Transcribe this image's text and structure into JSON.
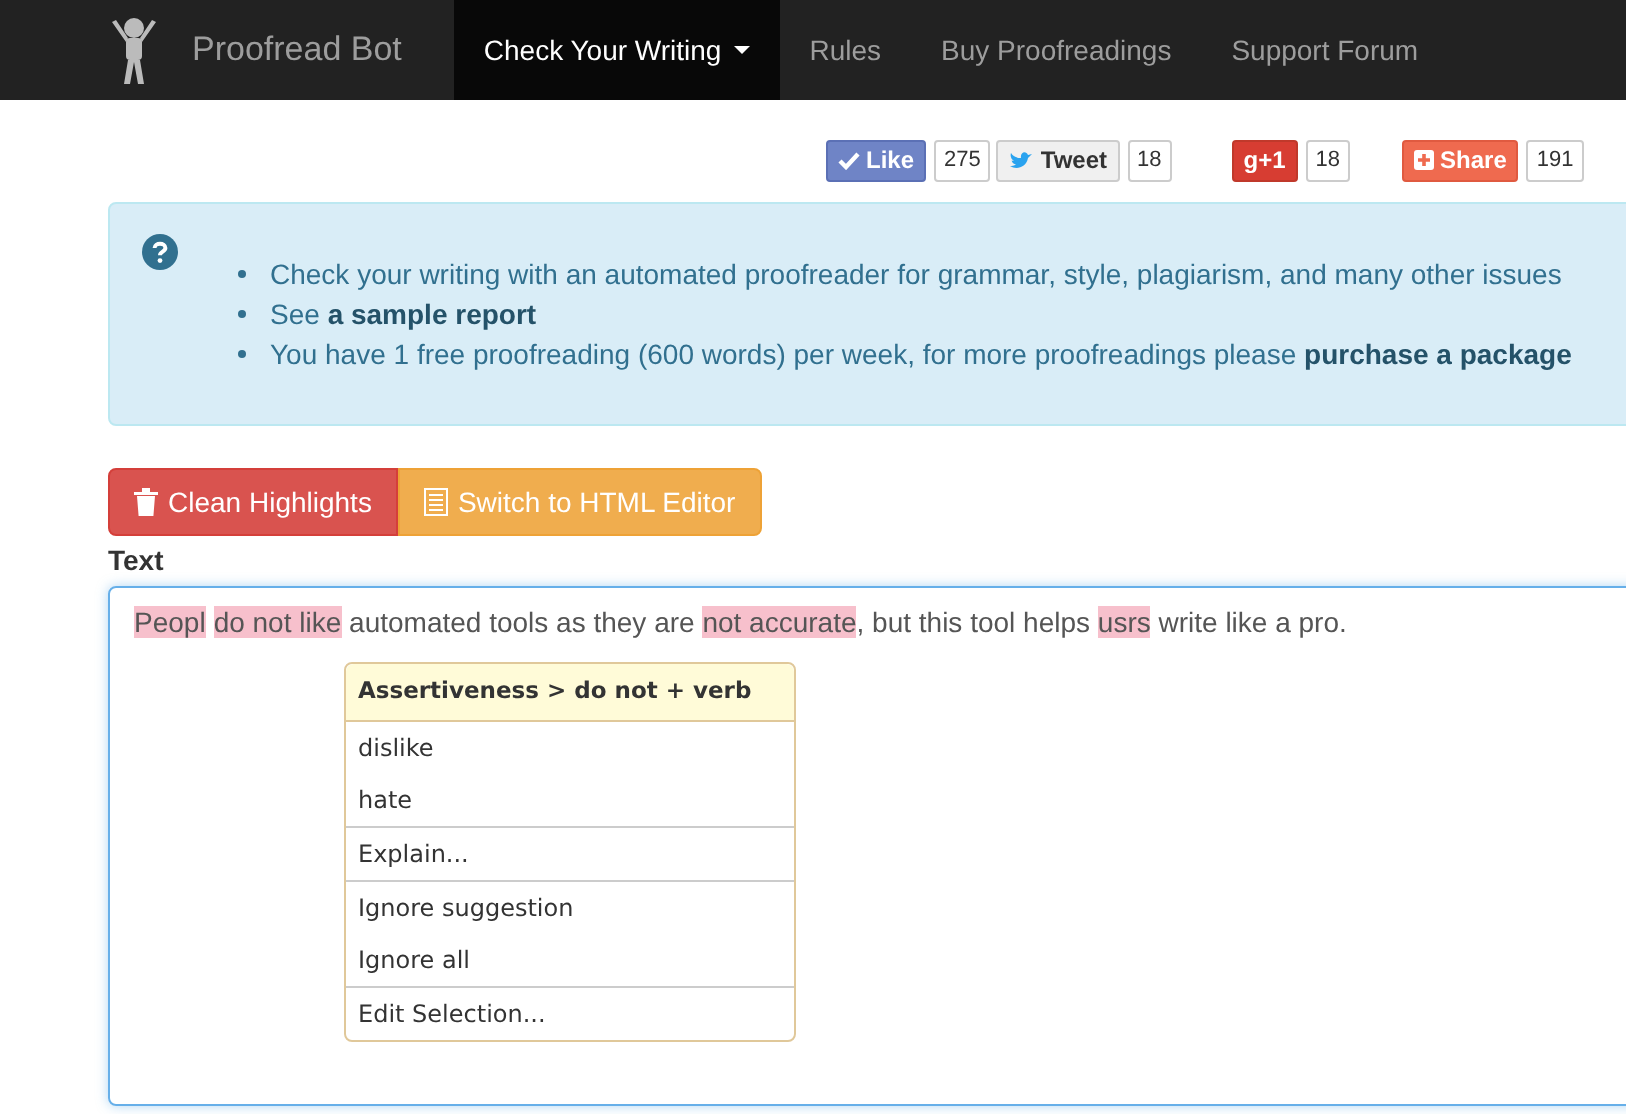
{
  "navbar": {
    "brand": "Proofread Bot",
    "items": [
      {
        "label": "Check Your Writing",
        "selected": true,
        "kind": "dropdown"
      },
      {
        "label": "Rules",
        "selected": false,
        "kind": "link"
      },
      {
        "label": "Buy Proofreadings",
        "selected": false,
        "kind": "link"
      },
      {
        "label": "Support Forum",
        "selected": false,
        "kind": "link"
      }
    ]
  },
  "social": [
    {
      "kind": "like",
      "label": "Like",
      "count": "275"
    },
    {
      "kind": "tweet",
      "label": "Tweet",
      "count": "18"
    },
    {
      "kind": "plusone",
      "label": "g+1",
      "count": "18"
    },
    {
      "kind": "share",
      "label": "Share",
      "count": "191"
    }
  ],
  "info": {
    "items": [
      "Check your writing with an automated proofreader for grammar, style, plagiarism, and many other issues",
      "See **a sample report**",
      "You have 1 free proofreading (600 words) per week, for more proofreadings please **purchase a package**"
    ]
  },
  "toolbar": [
    {
      "kind": "danger",
      "label": "Clean Highlights"
    },
    {
      "kind": "warning",
      "label": "Switch to HTML Editor"
    }
  ],
  "editor": {
    "label": "Text",
    "segments": [
      {
        "text": "Peopl",
        "highlighted": true
      },
      {
        "text": "do not like",
        "highlighted": true
      },
      {
        "text": " automated tools as they are ",
        "highlighted": false
      },
      {
        "text": "not accurate",
        "highlighted": true
      },
      {
        "text": ", but this tool helps ",
        "highlighted": false
      },
      {
        "text": "usrs",
        "highlighted": true
      },
      {
        "text": " write like a pro.",
        "highlighted": false
      }
    ]
  },
  "suggestion_menu": {
    "title": "Assertiveness > do not + verb",
    "groups": [
      [
        "dislike",
        "hate"
      ],
      [
        "Explain..."
      ],
      [
        "Ignore suggestion",
        "Ignore all"
      ],
      [
        "Edit Selection..."
      ]
    ]
  }
}
